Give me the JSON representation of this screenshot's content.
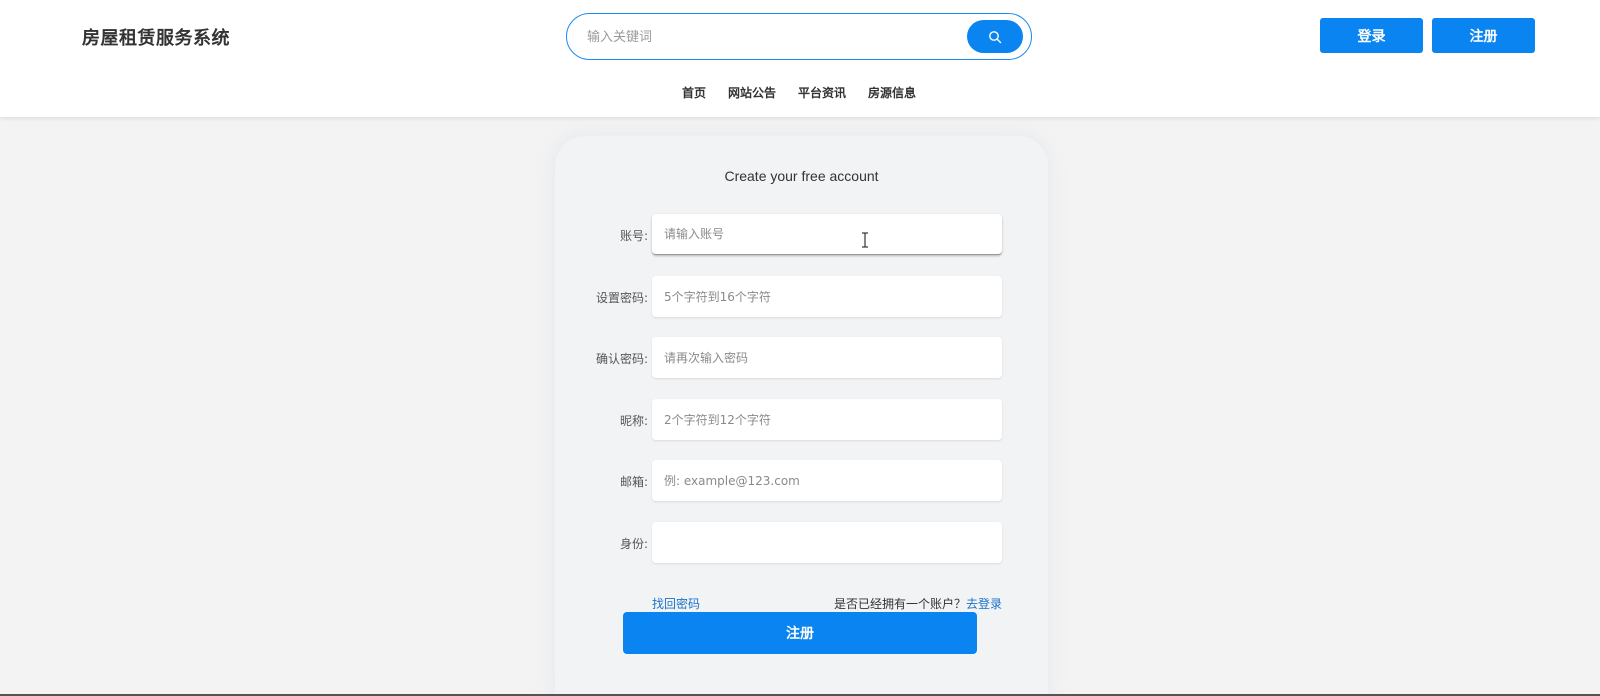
{
  "header": {
    "site_title": "房屋租赁服务系统",
    "search": {
      "placeholder": "输入关键词",
      "button_icon": "search-icon"
    },
    "login_label": "登录",
    "register_label": "注册",
    "nav": [
      {
        "label": "首页"
      },
      {
        "label": "网站公告"
      },
      {
        "label": "平台资讯"
      },
      {
        "label": "房源信息"
      }
    ]
  },
  "form": {
    "title": "Create your free account",
    "fields": [
      {
        "label": "账号:",
        "placeholder": "请输入账号"
      },
      {
        "label": "设置密码:",
        "placeholder": "5个字符到16个字符"
      },
      {
        "label": "确认密码:",
        "placeholder": "请再次输入密码"
      },
      {
        "label": "昵称:",
        "placeholder": "2个字符到12个字符"
      },
      {
        "label": "邮箱:",
        "placeholder": "例: example@123.com"
      },
      {
        "label": "身份:",
        "placeholder": ""
      }
    ],
    "forgot_password": "找回密码",
    "have_account": "是否已经拥有一个账户？",
    "goto_login": "去登录",
    "submit_label": "注册"
  },
  "colors": {
    "accent": "#0a84f0",
    "link": "#1a73c8",
    "background": "#f3f3f3"
  }
}
